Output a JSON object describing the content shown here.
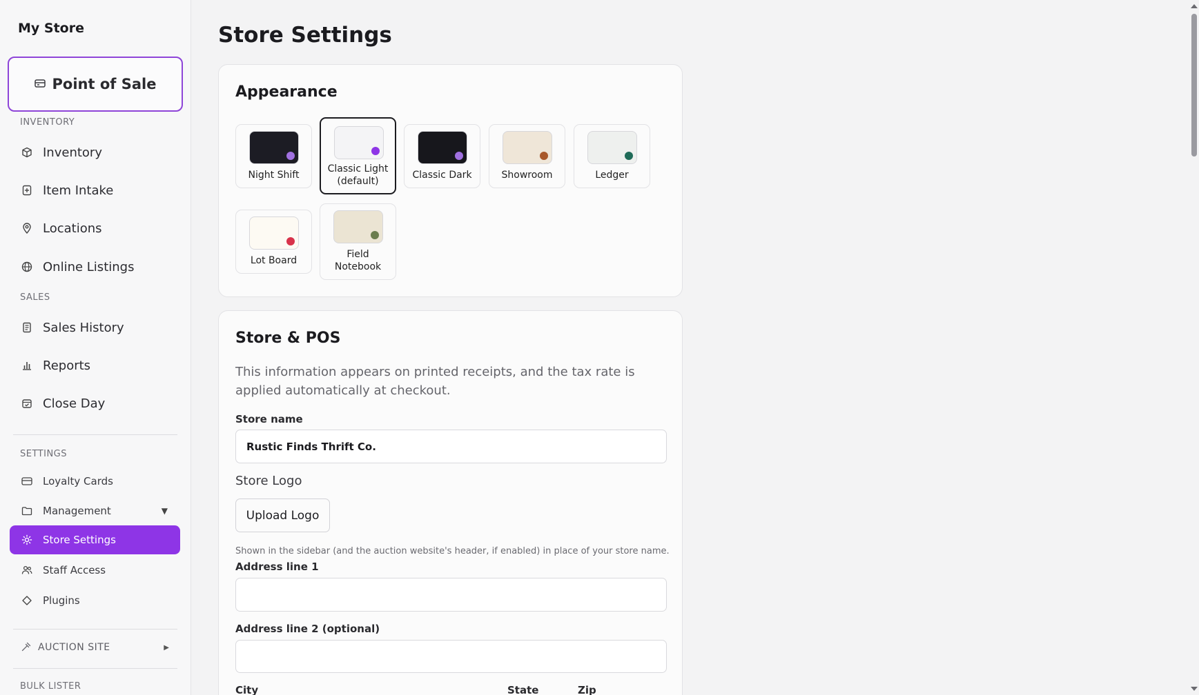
{
  "sidebar": {
    "store_title": "My Store",
    "pos_button": "Point of Sale",
    "sections": {
      "inventory": "INVENTORY",
      "sales": "SALES",
      "settings": "SETTINGS",
      "bulk_lister": "BULK LISTER"
    },
    "inventory_items": [
      "Inventory",
      "Item Intake",
      "Locations",
      "Online Listings"
    ],
    "sales_items": [
      "Sales History",
      "Reports",
      "Close Day"
    ],
    "settings_items": [
      "Loyalty Cards",
      "Management",
      "Store Settings",
      "Staff Access",
      "Plugins"
    ],
    "active_item": "Store Settings",
    "auction_site": "AUCTION SITE"
  },
  "page": {
    "title": "Store Settings"
  },
  "appearance": {
    "title": "Appearance",
    "themes": [
      {
        "name": "Night Shift",
        "bg": "#1c1c24",
        "inner": "#2a2a33",
        "dot": "#a070e0"
      },
      {
        "name": "Classic Light (default)",
        "line1": "Classic Light",
        "line2": "(default)",
        "bg": "#f4f4f6",
        "inner": "#fafafa",
        "dot": "#8e35e6",
        "selected": true
      },
      {
        "name": "Classic Dark",
        "bg": "#17171c",
        "inner": "#25252c",
        "dot": "#a070e0"
      },
      {
        "name": "Showroom",
        "bg": "#efe6d8",
        "inner": "#fbf7ef",
        "dot": "#a8582a"
      },
      {
        "name": "Ledger",
        "bg": "#eef0ee",
        "inner": "#ffffff",
        "dot": "#1f6b58"
      },
      {
        "name": "Lot Board",
        "bg": "#f8f4ec",
        "inner": "#fffdf8",
        "dot": "#d8324a"
      },
      {
        "name": "Field Notebook",
        "line1": "Field",
        "line2": "Notebook",
        "bg": "#e7e0cf",
        "inner": "#f3eee2",
        "dot": "#6b7d4e"
      }
    ]
  },
  "store_pos": {
    "title": "Store & POS",
    "description": "This information appears on printed receipts, and the tax rate is applied automatically at checkout.",
    "store_name_label": "Store name",
    "store_name_value": "Rustic Finds Thrift Co.",
    "logo_label": "Store Logo",
    "upload_button": "Upload Logo",
    "logo_hint": "Shown in the sidebar (and the auction website's header, if enabled) in place of your store name.",
    "address1_label": "Address line 1",
    "address1_value": "",
    "address2_label": "Address line 2 (optional)",
    "address2_value": "",
    "city_label": "City",
    "state_label": "State",
    "zip_label": "Zip"
  },
  "colors": {
    "accent": "#8e35e6",
    "pos_border": "#8e44d8"
  }
}
